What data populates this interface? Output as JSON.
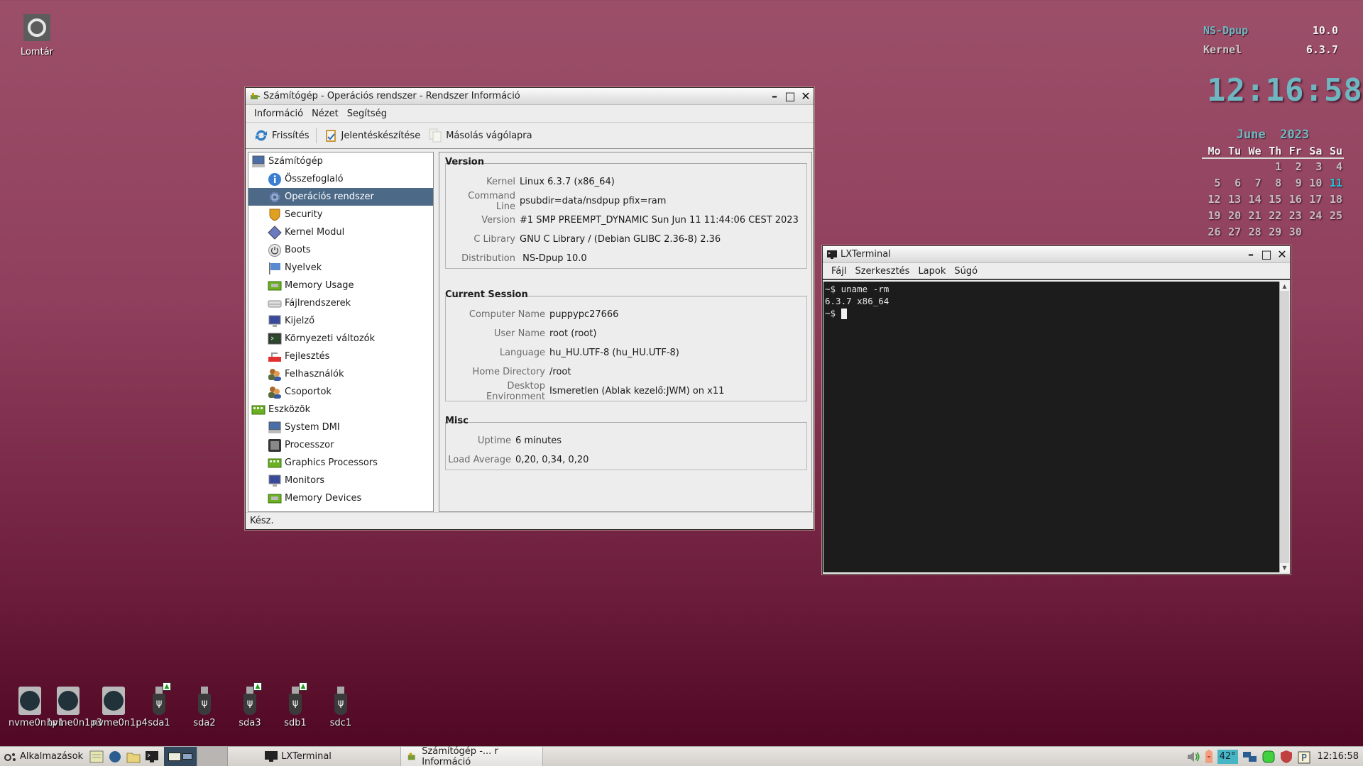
{
  "desktop": {
    "trash_label": "Lomtár",
    "drives": [
      {
        "label": "nvme0n1p1",
        "type": "nvme",
        "mounted": false
      },
      {
        "label": "nvme0n1p3",
        "type": "nvme",
        "mounted": false
      },
      {
        "label": "nvme0n1p4",
        "type": "nvme",
        "mounted": false
      },
      {
        "label": "sda1",
        "type": "usb",
        "mounted": true
      },
      {
        "label": "sda2",
        "type": "usb",
        "mounted": false
      },
      {
        "label": "sda3",
        "type": "usb",
        "mounted": true
      },
      {
        "label": "sdb1",
        "type": "usb",
        "mounted": true
      },
      {
        "label": "sdc1",
        "type": "usb",
        "mounted": false
      }
    ]
  },
  "conky": {
    "distro_label": "NS-Dpup",
    "distro_version": "10.0",
    "kernel_label": "Kernel",
    "kernel_version": "6.3.7",
    "time": "12:16:58",
    "calendar": {
      "month": "June",
      "year": "2023",
      "weekdays": [
        "Mo",
        "Tu",
        "We",
        "Th",
        "Fr",
        "Sa",
        "Su"
      ],
      "weeks": [
        [
          "",
          "",
          "",
          "1",
          "2",
          "3",
          "4"
        ],
        [
          "5",
          "6",
          "7",
          "8",
          "9",
          "10",
          "11"
        ],
        [
          "12",
          "13",
          "14",
          "15",
          "16",
          "17",
          "18"
        ],
        [
          "19",
          "20",
          "21",
          "22",
          "23",
          "24",
          "25"
        ],
        [
          "26",
          "27",
          "28",
          "29",
          "30",
          "",
          ""
        ]
      ],
      "today": "11",
      "today_color": "#1fc7d8"
    }
  },
  "hardinfo": {
    "title": "Számítógép - Operációs rendszer - Rendszer Információ",
    "menu": [
      "Információ",
      "Nézet",
      "Segítség"
    ],
    "toolbar": {
      "refresh": "Frissítés",
      "report": "Jelentéskészítése",
      "copy": "Másolás vágólapra"
    },
    "tree": [
      {
        "label": "Számítógép",
        "level": 0,
        "icon": "computer-icon"
      },
      {
        "label": "Összefoglaló",
        "level": 1,
        "icon": "info-icon"
      },
      {
        "label": "Operációs rendszer",
        "level": 1,
        "icon": "gear-icon",
        "selected": true
      },
      {
        "label": "Security",
        "level": 1,
        "icon": "shield-icon"
      },
      {
        "label": "Kernel Modul",
        "level": 1,
        "icon": "diamond-icon"
      },
      {
        "label": "Boots",
        "level": 1,
        "icon": "power-icon"
      },
      {
        "label": "Nyelvek",
        "level": 1,
        "icon": "flag-icon"
      },
      {
        "label": "Memory Usage",
        "level": 1,
        "icon": "memory-icon"
      },
      {
        "label": "Fájlrendszerek",
        "level": 1,
        "icon": "drive-icon"
      },
      {
        "label": "Kijelző",
        "level": 1,
        "icon": "monitor-icon"
      },
      {
        "label": "Környezeti változók",
        "level": 1,
        "icon": "terminal-icon"
      },
      {
        "label": "Fejlesztés",
        "level": 1,
        "icon": "devel-icon"
      },
      {
        "label": "Felhasználók",
        "level": 1,
        "icon": "users-icon"
      },
      {
        "label": "Csoportok",
        "level": 1,
        "icon": "groups-icon"
      },
      {
        "label": "Eszközök",
        "level": 0,
        "icon": "devices-icon"
      },
      {
        "label": "System DMI",
        "level": 1,
        "icon": "computer-icon"
      },
      {
        "label": "Processzor",
        "level": 1,
        "icon": "cpu-icon"
      },
      {
        "label": "Graphics Processors",
        "level": 1,
        "icon": "gpu-icon"
      },
      {
        "label": "Monitors",
        "level": 1,
        "icon": "monitor-icon"
      },
      {
        "label": "Memory Devices",
        "level": 1,
        "icon": "memory-icon"
      }
    ],
    "sections": {
      "version": {
        "title": "Version",
        "rows": [
          {
            "label": "Kernel",
            "value": "Linux 6.3.7 (x86_64)"
          },
          {
            "label": "Command Line",
            "value": "psubdir=data/nsdpup pfix=ram"
          },
          {
            "label": "Version",
            "value": "#1 SMP PREEMPT_DYNAMIC Sun Jun 11 11:44:06 CEST 2023"
          },
          {
            "label": "C Library",
            "value": "GNU C Library / (Debian GLIBC 2.36-8) 2.36"
          },
          {
            "label": "Distribution",
            "value": " NS-Dpup 10.0"
          }
        ]
      },
      "session": {
        "title": "Current Session",
        "rows": [
          {
            "label": "Computer Name",
            "value": "puppypc27666"
          },
          {
            "label": "User Name",
            "value": "root (root)"
          },
          {
            "label": "Language",
            "value": "hu_HU.UTF-8 (hu_HU.UTF-8)"
          },
          {
            "label": "Home Directory",
            "value": "/root"
          },
          {
            "label": "Desktop Environment",
            "value": "Ismeretlen (Ablak kezelő:JWM) on x11"
          }
        ]
      },
      "misc": {
        "title": "Misc",
        "rows": [
          {
            "label": "Uptime",
            "value": "6 minutes"
          },
          {
            "label": "Load Average",
            "value": "0,20, 0,34, 0,20"
          }
        ]
      }
    },
    "status": "Kész."
  },
  "terminal": {
    "title": "LXTerminal",
    "menu": [
      "Fájl",
      "Szerkesztés",
      "Lapok",
      "Súgó"
    ],
    "lines": [
      "~$ uname -rm",
      "6.3.7 x86_64",
      "~$ "
    ]
  },
  "taskbar": {
    "start_label": "Alkalmazások",
    "tasks": [
      {
        "label": "LXTerminal",
        "active": false
      },
      {
        "label": "Számítógép -... r Információ",
        "active": true
      }
    ],
    "tray": {
      "temperature": "42°",
      "clock": "12:16:58"
    }
  }
}
